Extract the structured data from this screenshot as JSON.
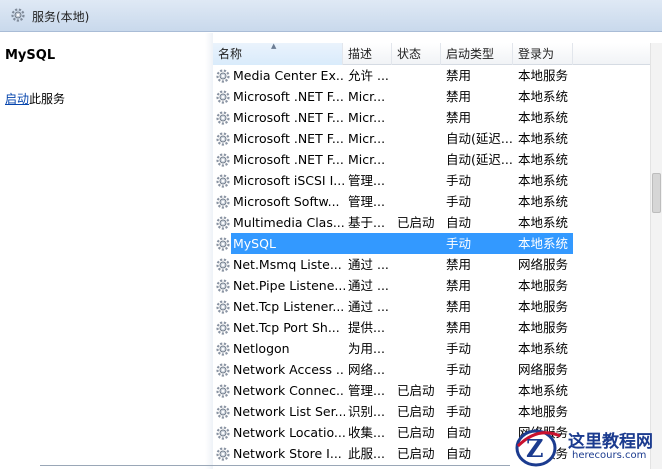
{
  "window": {
    "title": "服务(本地)",
    "icon": "gear-services-icon"
  },
  "left_pane": {
    "service_name": "MySQL",
    "start_link": "启动",
    "start_suffix": "此服务"
  },
  "table": {
    "columns": [
      "名称",
      "描述",
      "状态",
      "启动类型",
      "登录为"
    ],
    "sorted_column": "名称",
    "rows": [
      {
        "name": "Media Center Ex...",
        "desc": "允许 ...",
        "status": "",
        "startup": "禁用",
        "logon": "本地服务"
      },
      {
        "name": "Microsoft .NET F...",
        "desc": "Micr...",
        "status": "",
        "startup": "禁用",
        "logon": "本地系统"
      },
      {
        "name": "Microsoft .NET F...",
        "desc": "Micr...",
        "status": "",
        "startup": "禁用",
        "logon": "本地系统"
      },
      {
        "name": "Microsoft .NET F...",
        "desc": "Micr...",
        "status": "",
        "startup": "自动(延迟...",
        "logon": "本地系统"
      },
      {
        "name": "Microsoft .NET F...",
        "desc": "Micr...",
        "status": "",
        "startup": "自动(延迟...",
        "logon": "本地系统"
      },
      {
        "name": "Microsoft iSCSI I...",
        "desc": "管理...",
        "status": "",
        "startup": "手动",
        "logon": "本地系统"
      },
      {
        "name": "Microsoft Softw...",
        "desc": "管理...",
        "status": "",
        "startup": "手动",
        "logon": "本地系统"
      },
      {
        "name": "Multimedia Clas...",
        "desc": "基于...",
        "status": "已启动",
        "startup": "自动",
        "logon": "本地系统"
      },
      {
        "name": "MySQL",
        "desc": "",
        "status": "",
        "startup": "手动",
        "logon": "本地系统",
        "selected": true
      },
      {
        "name": "Net.Msmq Liste...",
        "desc": "通过 ...",
        "status": "",
        "startup": "禁用",
        "logon": "网络服务"
      },
      {
        "name": "Net.Pipe Listene...",
        "desc": "通过 ...",
        "status": "",
        "startup": "禁用",
        "logon": "本地服务"
      },
      {
        "name": "Net.Tcp Listener...",
        "desc": "通过 ...",
        "status": "",
        "startup": "禁用",
        "logon": "本地服务"
      },
      {
        "name": "Net.Tcp Port Sh...",
        "desc": "提供...",
        "status": "",
        "startup": "禁用",
        "logon": "本地服务"
      },
      {
        "name": "Netlogon",
        "desc": "为用...",
        "status": "",
        "startup": "手动",
        "logon": "本地系统"
      },
      {
        "name": "Network Access ...",
        "desc": "网络...",
        "status": "",
        "startup": "手动",
        "logon": "网络服务"
      },
      {
        "name": "Network Connec...",
        "desc": "管理...",
        "status": "已启动",
        "startup": "手动",
        "logon": "本地系统"
      },
      {
        "name": "Network List Ser...",
        "desc": "识别...",
        "status": "已启动",
        "startup": "手动",
        "logon": "本地服务"
      },
      {
        "name": "Network Locatio...",
        "desc": "收集...",
        "status": "已启动",
        "startup": "自动",
        "logon": "网络服务"
      },
      {
        "name": "Network Store I...",
        "desc": "此服...",
        "status": "已启动",
        "startup": "自动",
        "logon": "本地服务"
      }
    ]
  },
  "watermark": {
    "text": "这里教程网",
    "url": "herecours.com"
  },
  "colors": {
    "selection": "#3399ff",
    "link": "#0645ad",
    "watermark": "#1b3b8f"
  }
}
